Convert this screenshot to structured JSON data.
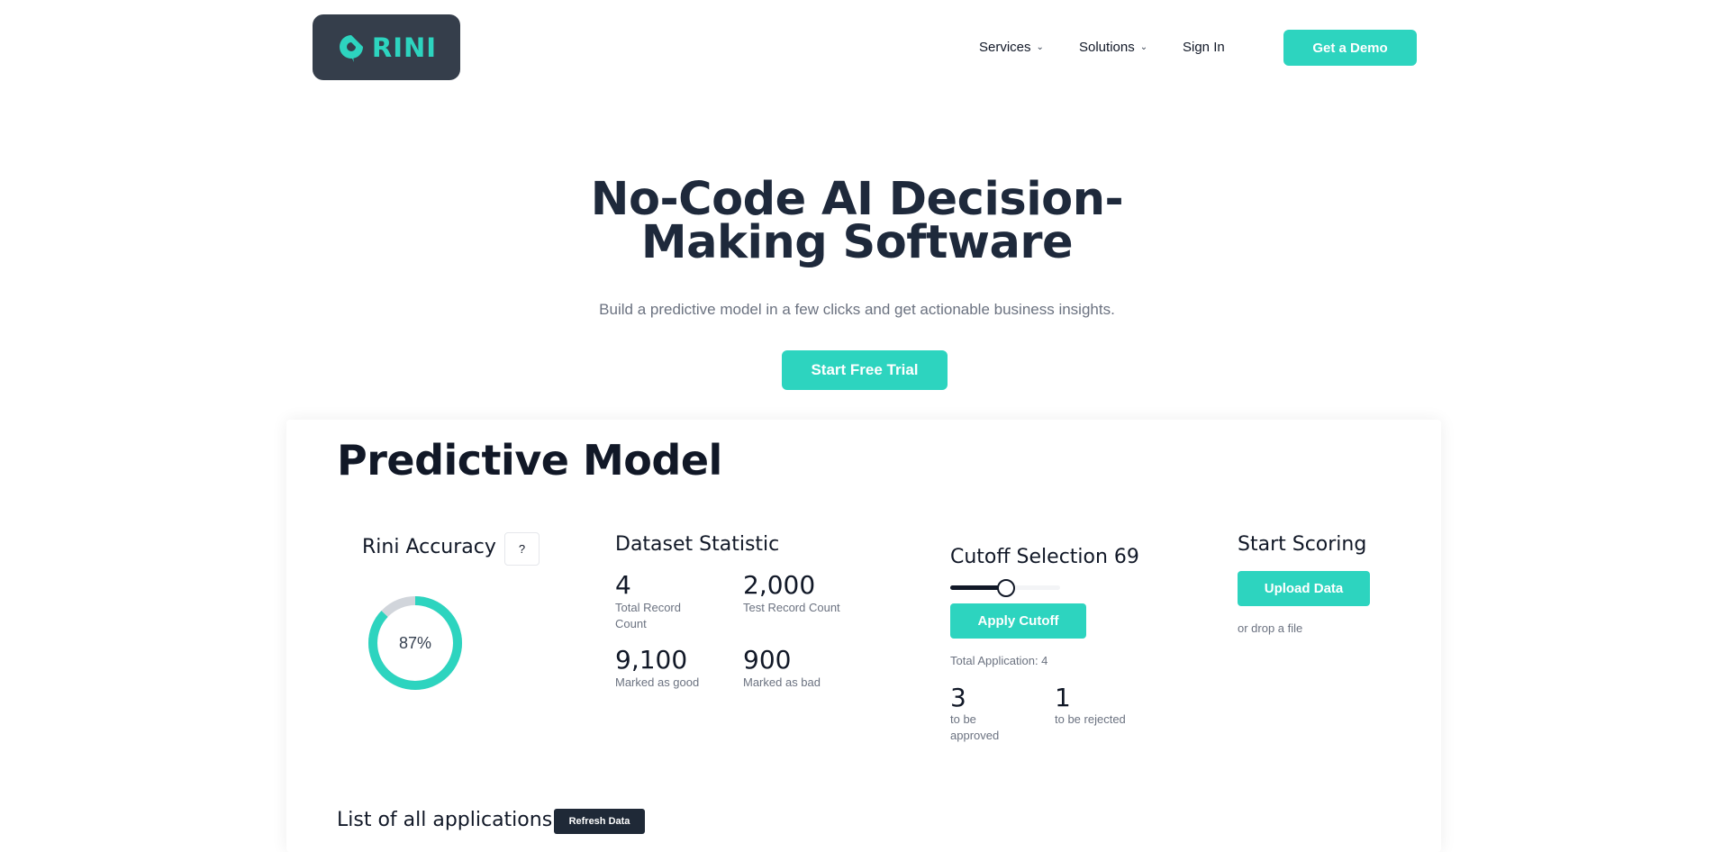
{
  "header": {
    "logo_text": "RINI",
    "nav": [
      {
        "label": "Services",
        "has_dropdown": true
      },
      {
        "label": "Solutions",
        "has_dropdown": true
      },
      {
        "label": "Sign In",
        "has_dropdown": false
      }
    ],
    "demo_label": "Get a Demo"
  },
  "hero": {
    "title_line1": "No-Code AI Decision-",
    "title_line2": "Making Software",
    "subtitle": "Build a predictive model in a few clicks and get actionable business insights.",
    "cta_label": "Start Free Trial"
  },
  "model": {
    "title": "Predictive Model",
    "accuracy": {
      "title": "Rini Accuracy",
      "help_label": "?",
      "value_label": "87%",
      "value": 0.87
    },
    "dataset": {
      "title": "Dataset Statistic",
      "stats": [
        {
          "value": "4",
          "label": "Total Record Count"
        },
        {
          "value": "2,000",
          "label": "Test Record Count"
        },
        {
          "value": "9,100",
          "label": "Marked as good"
        },
        {
          "value": "900",
          "label": "Marked as bad"
        }
      ]
    },
    "cutoff": {
      "title": "Cutoff Selection 69",
      "slider_value": 0.5,
      "apply_label": "Apply Cutoff",
      "total_label": "Total Application: 4",
      "approved_value": "3",
      "approved_label": "to be approved",
      "rejected_value": "1",
      "rejected_label": "to be rejected"
    },
    "scoring": {
      "title": "Start Scoring",
      "upload_label": "Upload Data",
      "drop_label": "or drop a file"
    },
    "list": {
      "title": "List of all applications",
      "refresh_label": "Refresh Data"
    }
  },
  "colors": {
    "accent": "#2dd4bf",
    "logo_bg": "#353e4b",
    "dark": "#1f2937"
  }
}
